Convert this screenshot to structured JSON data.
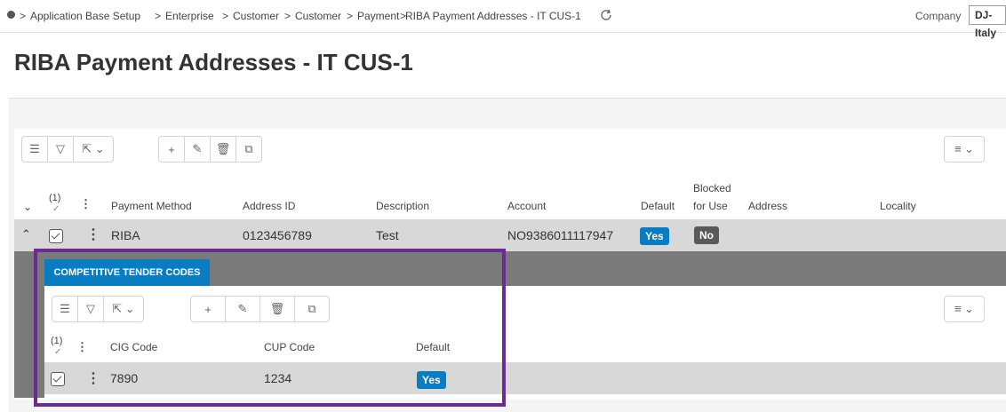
{
  "breadcrumb": {
    "items": [
      "Application Base Setup",
      "Enterprise",
      "Customer",
      "Customer",
      "Payment",
      "RIBA Payment Addresses - IT CUS-1"
    ],
    "separator": ">"
  },
  "company": {
    "label": "Company",
    "value": "DJ- Italy"
  },
  "page_title": "RIBA Payment Addresses - IT CUS-1",
  "main_table": {
    "selected_count": "(1)",
    "columns": {
      "payment_method": "Payment Method",
      "address_id": "Address ID",
      "description": "Description",
      "account": "Account",
      "default": "Default",
      "blocked_line1": "Blocked",
      "blocked_line2": "for Use",
      "address": "Address",
      "locality": "Locality"
    },
    "row": {
      "payment_method": "RIBA",
      "address_id": "0123456789",
      "description": "Test",
      "account": "NO9386011117947",
      "default": "Yes",
      "blocked": "No"
    }
  },
  "detail": {
    "tab_label": "COMPETITIVE TENDER CODES",
    "selected_count": "(1)",
    "columns": {
      "cig": "CIG Code",
      "cup": "CUP Code",
      "default": "Default"
    },
    "row": {
      "cig": "7890",
      "cup": "1234",
      "default": "Yes"
    }
  },
  "icons": {
    "toolbar": [
      "list-icon",
      "filter-icon",
      "export-icon",
      "add-icon",
      "edit-icon",
      "delete-icon",
      "copy-icon"
    ],
    "view": "view-options-icon"
  },
  "colors": {
    "accent": "#0a7cc1",
    "highlight_border": "#6a2c91",
    "badge_no": "#5a5a5a"
  }
}
